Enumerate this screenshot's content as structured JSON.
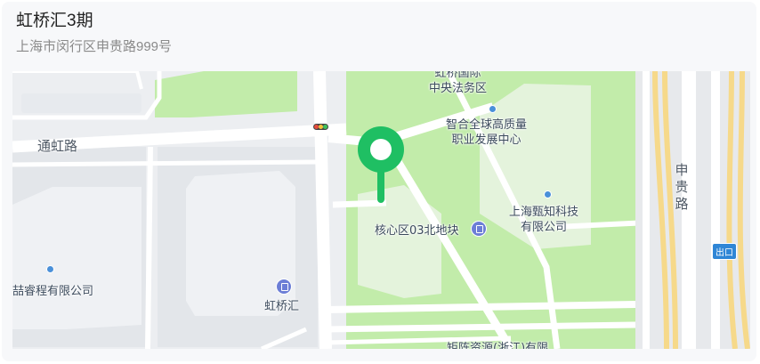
{
  "location": {
    "name": "虹桥汇3期",
    "address": "上海市闵行区申贵路999号"
  },
  "map": {
    "roads": {
      "tonghong": "通虹路",
      "shengui": "申贵路"
    },
    "places": {
      "legal_zone": "虹桥国际\n中央法务区",
      "quality_center": "智合全球高质量\n职业发展中心",
      "core_plot": "核心区03北地块",
      "zhenzhi": "上海甄知科技\n有限公司",
      "hongqiaohui": "虹桥汇",
      "left_company": "喆睿程有限公司",
      "juzhen": "矩阵资源(浙江)有限"
    },
    "exit_badge": "出口",
    "colors": {
      "green_area": "#c2ecaa",
      "pin": "#1fbf63",
      "highway": "#f6d98a"
    },
    "marker_icon": "location-pin-icon"
  }
}
